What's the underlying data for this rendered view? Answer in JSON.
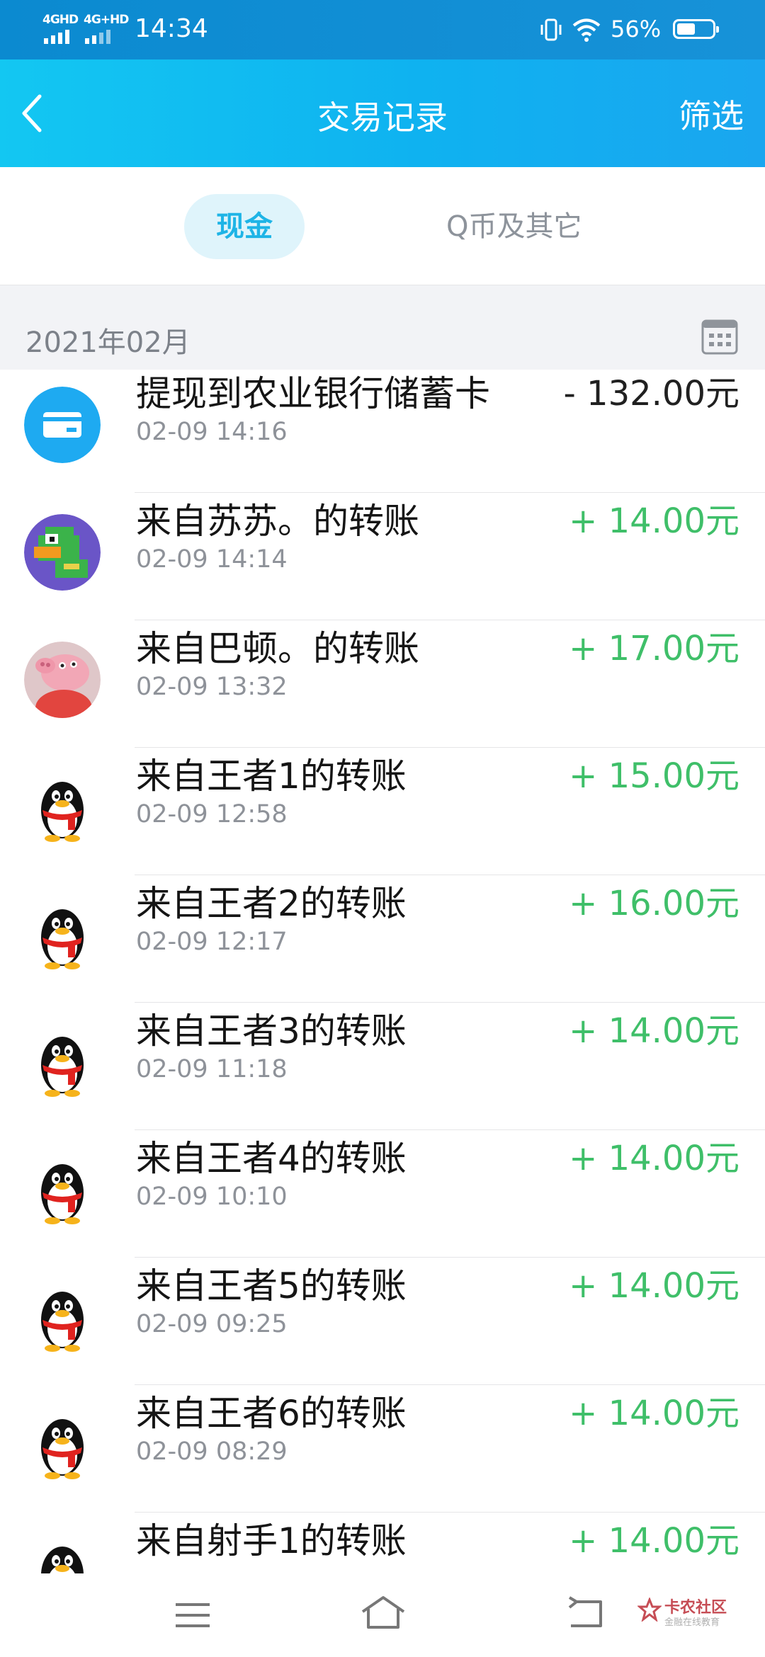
{
  "status_bar": {
    "signal1": "4GHD",
    "signal2": "4G+HD",
    "time": "14:34",
    "battery": "56%",
    "battery_level": 0.56
  },
  "header": {
    "back_icon": "chevron-left-icon",
    "title": "交易记录",
    "filter_label": "筛选"
  },
  "tabs": [
    {
      "label": "现金",
      "active": true
    },
    {
      "label": "Q币及其它",
      "active": false
    }
  ],
  "month": {
    "label": "2021年02月",
    "icon": "calendar-icon"
  },
  "transactions": [
    {
      "name": "提现到农业银行储蓄卡",
      "time": "02-09 14:16",
      "amount": "- 132.00元",
      "type": "withdraw",
      "avatar": "bank-card-icon"
    },
    {
      "name": "来自苏苏。的转账",
      "time": "02-09 14:14",
      "amount": "+ 14.00元",
      "type": "income",
      "avatar": "pixel-duck-avatar"
    },
    {
      "name": "来自巴顿。的转账",
      "time": "02-09 13:32",
      "amount": "+ 17.00元",
      "type": "income",
      "avatar": "pink-pig-avatar"
    },
    {
      "name": "来自王者1的转账",
      "time": "02-09 12:58",
      "amount": "+ 15.00元",
      "type": "income",
      "avatar": "penguin-avatar"
    },
    {
      "name": "来自王者2的转账",
      "time": "02-09 12:17",
      "amount": "+ 16.00元",
      "type": "income",
      "avatar": "penguin-avatar"
    },
    {
      "name": "来自王者3的转账",
      "time": "02-09 11:18",
      "amount": "+ 14.00元",
      "type": "income",
      "avatar": "penguin-avatar"
    },
    {
      "name": "来自王者4的转账",
      "time": "02-09 10:10",
      "amount": "+ 14.00元",
      "type": "income",
      "avatar": "penguin-avatar"
    },
    {
      "name": "来自王者5的转账",
      "time": "02-09 09:25",
      "amount": "+ 14.00元",
      "type": "income",
      "avatar": "penguin-avatar"
    },
    {
      "name": "来自王者6的转账",
      "time": "02-09 08:29",
      "amount": "+ 14.00元",
      "type": "income",
      "avatar": "penguin-avatar"
    },
    {
      "name": "来自射手1的转账",
      "time": "",
      "amount": "+ 14.00元",
      "type": "income",
      "avatar": "penguin-avatar"
    }
  ],
  "nav_bar": {
    "menu_icon": "menu-icon",
    "home_icon": "home-icon",
    "back_icon": "back-icon"
  },
  "watermark": {
    "title": "卡农社区",
    "subtitle": "金融在线教育"
  },
  "colors": {
    "header_start": "#13c7f2",
    "header_end": "#1aa6ef",
    "income_green": "#3fbf69",
    "tab_active_text": "#1eb4e6",
    "tab_active_bg": "#dff4fb"
  }
}
